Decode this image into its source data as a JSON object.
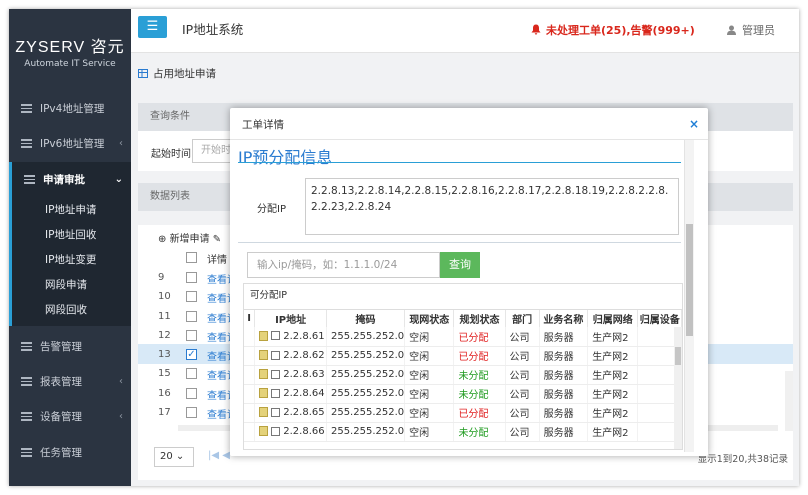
{
  "logo": {
    "brand": "ZYSERV 咨元",
    "tagline": "Automate IT Service"
  },
  "sidebar": {
    "items": [
      {
        "label": "IPv4地址管理",
        "chevron": ""
      },
      {
        "label": "IPv6地址管理",
        "chevron": "‹"
      },
      {
        "label": "申请审批",
        "chevron": "⌄"
      },
      {
        "label": "告警管理",
        "chevron": ""
      },
      {
        "label": "报表管理",
        "chevron": "‹"
      },
      {
        "label": "设备管理",
        "chevron": "‹"
      },
      {
        "label": "任务管理",
        "chevron": ""
      }
    ],
    "subitems": [
      "IP地址申请",
      "IP地址回收",
      "IP地址变更",
      "网段申请",
      "网段回收"
    ]
  },
  "header": {
    "menu_icon": "☰",
    "title": "IP地址系统",
    "alert_icon": "bell-icon",
    "alert_text": "未处理工单(25),告警(999+)",
    "user": "管理员"
  },
  "page": {
    "breadcrumb": "占用地址申请",
    "query_title": "查询条件",
    "start_time_label": "起始时间",
    "start_placeholder": "开始时",
    "list_title": "数据列表",
    "add_button": "新增申请",
    "detail_header": "详情",
    "rows": [
      {
        "num": "9",
        "link": "查看详情"
      },
      {
        "num": "10",
        "link": "查看详情"
      },
      {
        "num": "11",
        "link": "查看详情"
      },
      {
        "num": "12",
        "link": "查看详情"
      },
      {
        "num": "13",
        "link": "查看详情"
      },
      {
        "num": "15",
        "link": "查看详情"
      },
      {
        "num": "16",
        "link": "查看详情"
      },
      {
        "num": "17",
        "link": "查看详情"
      }
    ],
    "page_size": "20",
    "pager_text": "显示1到20,共38记录"
  },
  "modal": {
    "title": "工单详情",
    "close": "×",
    "section_title": "IP预分配信息",
    "ip_label": "分配IP",
    "ip_value": "2.2.8.13,2.2.8.14,2.2.8.15,2.2.8.16,2.2.8.17,2.2.8.18.19,2.2.8.2.2.8.2.2.23,2.2.8.24",
    "query_placeholder": "输入ip/掩码，如：1.1.1.0/24",
    "query_button": "查询",
    "table_title": "可分配IP",
    "columns": [
      "I",
      "IP地址",
      "掩码",
      "现网状态",
      "规划状态",
      "部门",
      "业务名称",
      "归属网络",
      "归属设备"
    ],
    "rows": [
      {
        "ip": "2.2.8.61",
        "mask": "255.255.252.0",
        "net": "空闲",
        "plan": "已分配",
        "dept": "公司",
        "biz": "服务器",
        "network": "生产网2"
      },
      {
        "ip": "2.2.8.62",
        "mask": "255.255.252.0",
        "net": "空闲",
        "plan": "已分配",
        "dept": "公司",
        "biz": "服务器",
        "network": "生产网2"
      },
      {
        "ip": "2.2.8.63",
        "mask": "255.255.252.0",
        "net": "空闲",
        "plan": "未分配",
        "dept": "公司",
        "biz": "服务器",
        "network": "生产网2"
      },
      {
        "ip": "2.2.8.64",
        "mask": "255.255.252.0",
        "net": "空闲",
        "plan": "未分配",
        "dept": "公司",
        "biz": "服务器",
        "network": "生产网2"
      },
      {
        "ip": "2.2.8.65",
        "mask": "255.255.252.0",
        "net": "空闲",
        "plan": "已分配",
        "dept": "公司",
        "biz": "服务器",
        "network": "生产网2"
      },
      {
        "ip": "2.2.8.66",
        "mask": "255.255.252.0",
        "net": "空闲",
        "plan": "未分配",
        "dept": "公司",
        "biz": "服务器",
        "network": "生产网2"
      }
    ]
  },
  "colors": {
    "sidebar": "#2b3441",
    "accent": "#2a9fd6",
    "alert": "#d9271c",
    "assigned": "#e02020",
    "unassigned": "#1d9a1d"
  }
}
